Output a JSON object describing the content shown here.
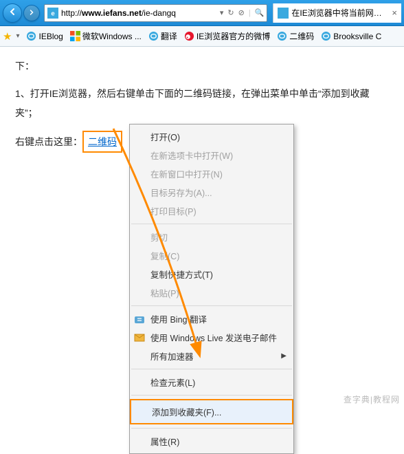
{
  "nav": {
    "address_prefix": "http://",
    "address_host": "www.iefans.net",
    "address_path": "/ie-dangq",
    "tab_title": "在IE浏览器中将当前网页网..."
  },
  "favs": {
    "items": [
      {
        "label": "IEBlog",
        "icon": "ie"
      },
      {
        "label": "微软Windows ...",
        "icon": "win"
      },
      {
        "label": "翻译",
        "icon": "ie"
      },
      {
        "label": "IE浏览器官方的微博",
        "icon": "weibo"
      },
      {
        "label": "二维码",
        "icon": "ie"
      },
      {
        "label": "Brooksville C",
        "icon": "ie"
      }
    ]
  },
  "page": {
    "line0": "下：",
    "line1_prefix": "1、打开IE浏览器，然后右键单击下面的二维码链接，在弹出菜单中单击",
    "line1_quote": "“添加到收藏夹”",
    "line1_suffix": "；",
    "line2_prefix": "右键点击这里：",
    "qr_link": "二维码"
  },
  "menu": {
    "open": "打开(O)",
    "open_tab": "在新选项卡中打开(W)",
    "open_window": "在新窗口中打开(N)",
    "save_target": "目标另存为(A)...",
    "print_target": "打印目标(P)",
    "cut": "剪切",
    "copy": "复制(C)",
    "copy_shortcut": "复制快捷方式(T)",
    "paste": "粘贴(P)",
    "bing_translate": "使用 Bing 翻译",
    "live_mail": "使用 Windows Live 发送电子邮件",
    "accelerators": "所有加速器",
    "inspect": "检查元素(L)",
    "add_fav": "添加到收藏夹(F)...",
    "properties": "属性(R)"
  },
  "watermark": "查字典|教程网"
}
